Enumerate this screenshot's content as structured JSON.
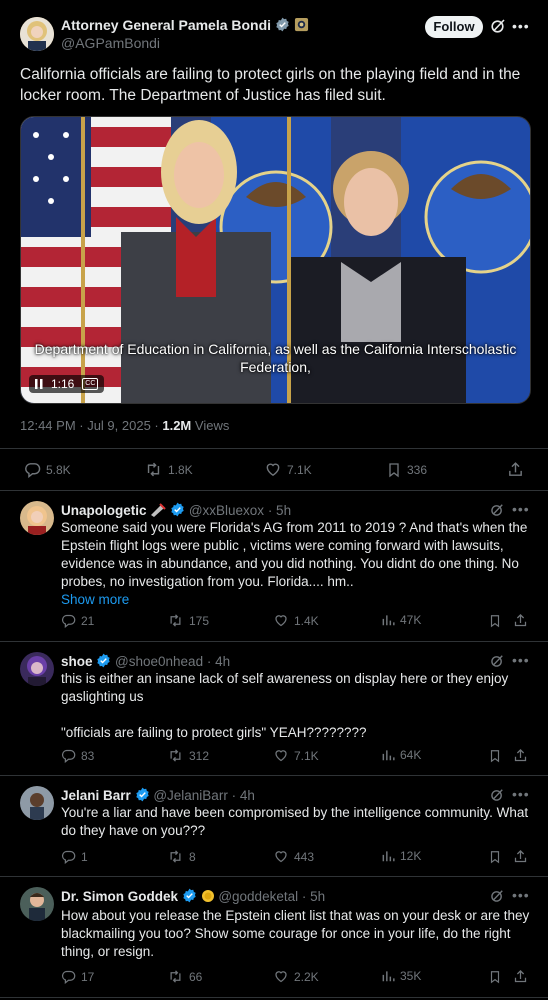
{
  "main_post": {
    "author_name": "Attorney General Pamela Bondi",
    "handle": "@AGPamBondi",
    "follow_label": "Follow",
    "text": "California officials are failing to protect girls on the playing field and in the locker room. The Department of Justice has filed suit.",
    "video": {
      "caption_line1": "Department of Education in California, as well  as the California Interscholastic",
      "caption_line2": "Federation,",
      "time": "1:16",
      "cc_label": "CC"
    },
    "timestamp": "12:44 PM · Jul 9, 2025 · ",
    "views_count": "1.2M",
    "views_label": "Views",
    "stats": {
      "replies": "5.8K",
      "reposts": "1.8K",
      "likes": "7.1K",
      "bookmarks": "336"
    }
  },
  "replies": [
    {
      "name": "Unapologetic",
      "handle": "@xxBluexox",
      "time": "· 5h",
      "text": "Someone said you were Florida's AG from 2011 to 2019 ? And that's when the Epstein flight logs were public , victims were coming forward with lawsuits, evidence was in abundance,  and you did nothing. You didnt do one thing. No probes, no investigation from you. Florida.... hm..",
      "show_more": "Show more",
      "stats": {
        "replies": "21",
        "reposts": "175",
        "likes": "1.4K",
        "views": "47K"
      }
    },
    {
      "name": "shoe",
      "handle": "@shoe0nhead",
      "time": "· 4h",
      "text_line1": "this is either an insane lack of self awareness on display here or they enjoy gaslighting us",
      "text_line2": "\"officials are failing to protect girls\" YEAH????????",
      "stats": {
        "replies": "83",
        "reposts": "312",
        "likes": "7.1K",
        "views": "64K"
      }
    },
    {
      "name": "Jelani Barr",
      "handle": "@JelaniBarr",
      "time": "· 4h",
      "text": "You're a liar and have been compromised by the intelligence community. What do they have on you???",
      "stats": {
        "replies": "1",
        "reposts": "8",
        "likes": "443",
        "views": "12K"
      }
    },
    {
      "name": "Dr. Simon Goddek",
      "handle": "@goddeketal",
      "time": "· 5h",
      "text": "How about you release the Epstein client list that was on your desk or are they blackmailing you too? Show some courage for once in your life, do the right thing, or resign.",
      "stats": {
        "replies": "17",
        "reposts": "66",
        "likes": "2.2K",
        "views": "35K"
      }
    }
  ],
  "colors": {
    "accent": "#1d9bf0",
    "muted": "#71767b",
    "text": "#e7e9ea",
    "border": "#2f3336",
    "background": "#000000"
  },
  "icons": [
    "verified-badge-icon",
    "grok-icon",
    "more-icon",
    "reply-icon",
    "repost-icon",
    "like-icon",
    "views-icon",
    "bookmark-icon",
    "share-icon"
  ]
}
